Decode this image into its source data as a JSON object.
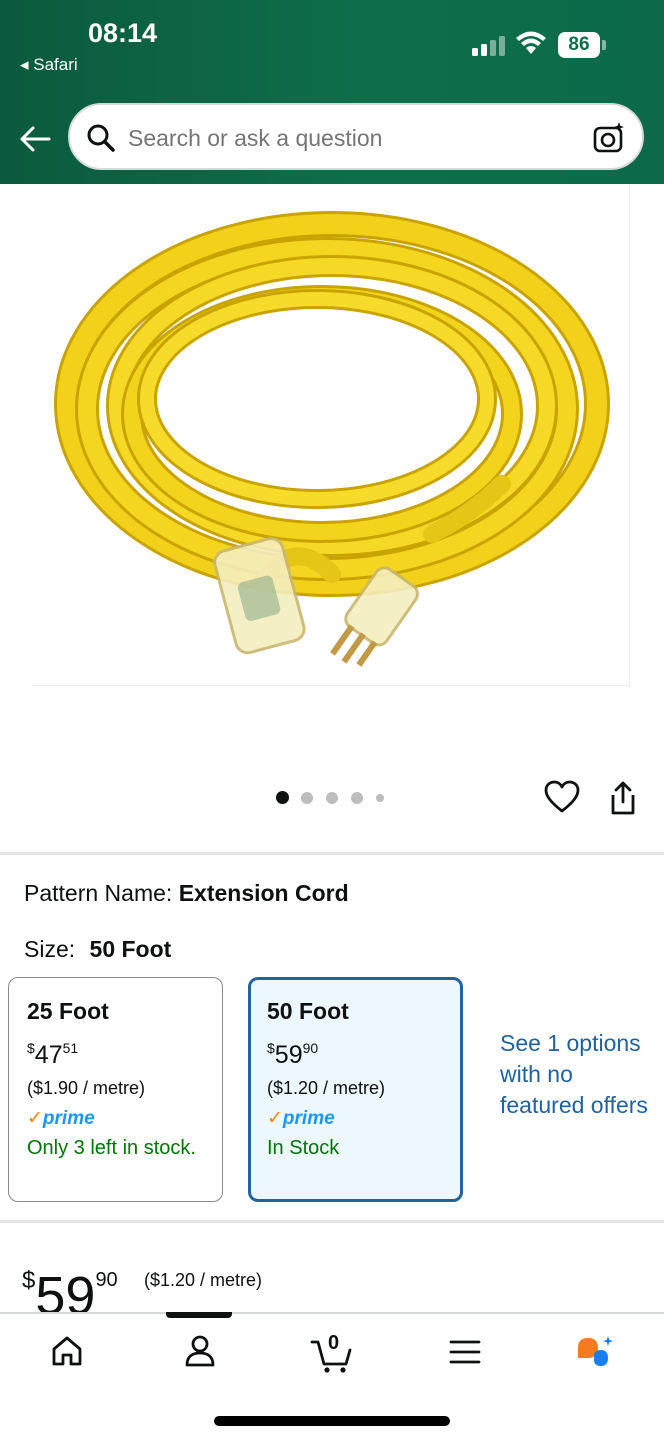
{
  "status_bar": {
    "time": "08:14",
    "back_app": "Safari",
    "battery": "86"
  },
  "search": {
    "placeholder": "Search or ask a question"
  },
  "product": {
    "image_icon": "yellow-extension-cord-image",
    "carousel_dots": 5,
    "carousel_active": 0
  },
  "pattern": {
    "label": "Pattern Name:",
    "value": "Extension Cord"
  },
  "size": {
    "label": "Size:",
    "value": "50 Foot"
  },
  "options": [
    {
      "title": "25 Foot",
      "currency": "$",
      "price_whole": "47",
      "price_frac": "51",
      "unit_price": "($1.90 / metre)",
      "prime": "prime",
      "availability": "Only 3 left in stock.",
      "selected": false
    },
    {
      "title": "50 Foot",
      "currency": "$",
      "price_whole": "59",
      "price_frac": "90",
      "unit_price": "($1.20 / metre)",
      "prime": "prime",
      "availability": "In Stock",
      "selected": true
    }
  ],
  "see_options": "See 1 options with no featured offers",
  "price": {
    "currency": "$",
    "whole": "59",
    "frac": "90",
    "unit": "($1.20 / metre)"
  },
  "tabbar": {
    "items": [
      "home-icon",
      "account-icon",
      "cart-icon",
      "menu-icon",
      "rufus-icon"
    ],
    "cart_count": "0"
  },
  "colors": {
    "header": "#0e6e4a",
    "link": "#2162a1",
    "in_stock": "#007600",
    "prime": "#1a98ff",
    "selected_bg": "#edf8fe"
  }
}
